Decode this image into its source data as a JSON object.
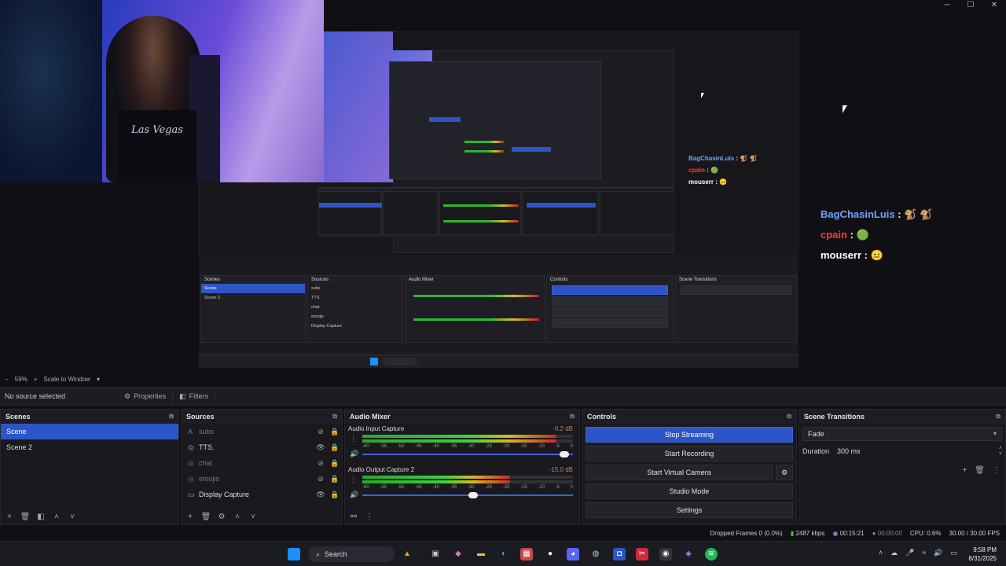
{
  "window_controls": [
    "─",
    "☐",
    "✕"
  ],
  "webcam": {
    "shirt_text": "Las Vegas"
  },
  "chat_overlay": {
    "messages": [
      {
        "user": "BagChasinLuis",
        "sep": ":",
        "emotes": "🐒 🐒"
      },
      {
        "user": "cpain",
        "sep": ":",
        "emotes": "🟢"
      },
      {
        "user": "mouserr",
        "sep": ":",
        "emotes": "😐"
      }
    ]
  },
  "preview": {
    "zoom": "59%",
    "scale_mode": "Scale to Window"
  },
  "source_bar": {
    "label": "No source selected",
    "properties": "Properties",
    "filters": "Filters"
  },
  "scenes": {
    "title": "Scenes",
    "items": [
      "Scene",
      "Scene 2"
    ],
    "selected": "Scene"
  },
  "sources": {
    "title": "Sources",
    "items": [
      {
        "name": "subs",
        "visible": false
      },
      {
        "name": "TTS.",
        "visible": true
      },
      {
        "name": "chat",
        "visible": false
      },
      {
        "name": "emojis",
        "visible": false
      },
      {
        "name": "Display Capture",
        "visible": true
      }
    ]
  },
  "audio_mixer": {
    "title": "Audio Mixer",
    "channels": [
      {
        "name": "Audio Input Capture",
        "db": "-0.2 dB",
        "level": 0.92,
        "volume": 0.98
      },
      {
        "name": "Audio Output Capture 2",
        "db": "-15.0 dB",
        "level": 0.7,
        "volume": 0.55
      }
    ],
    "scale": [
      "-60",
      "-55",
      "-50",
      "-45",
      "-40",
      "-35",
      "-30",
      "-25",
      "-20",
      "-15",
      "-10",
      "-5",
      "0"
    ]
  },
  "controls": {
    "title": "Controls",
    "buttons": [
      "Stop Streaming",
      "Start Recording",
      "Start Virtual Camera",
      "Studio Mode",
      "Settings"
    ],
    "active": "Stop Streaming"
  },
  "scene_transitions": {
    "title": "Scene Transitions",
    "transition": "Fade",
    "duration_label": "Duration",
    "duration_value": "300 ms"
  },
  "status": {
    "dropped": "Dropped Frames 0 (0.0%)",
    "bitrate": "2487 kbps",
    "stream_time": "00:15:21",
    "rec_time": "00:00:00",
    "cpu": "CPU: 0.6%",
    "fps": "30.00 / 30.00 FPS"
  },
  "taskbar": {
    "search": "Search",
    "time": "9:58 PM",
    "date": "8/31/2025"
  },
  "colors": {
    "accent": "#2d55c8",
    "panel": "#19191e",
    "background": "#101014"
  }
}
